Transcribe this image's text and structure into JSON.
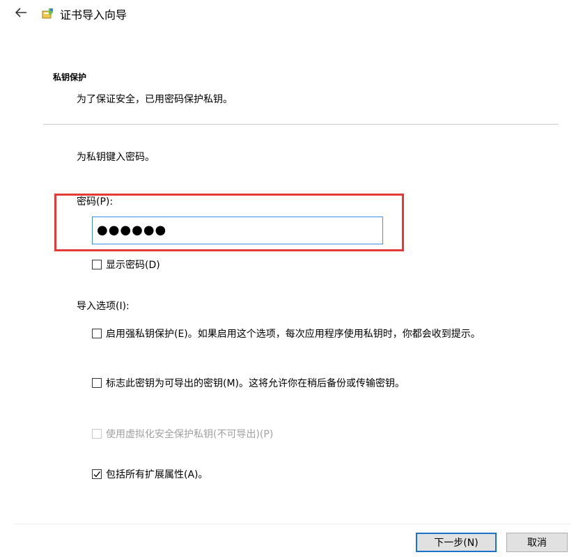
{
  "header": {
    "title": "证书导入向导",
    "back_icon": "back-arrow-icon",
    "app_icon": "certificate-wizard-icon"
  },
  "section": {
    "title": "私钥保护",
    "description": "为了保证安全，已用密码保护私钥。"
  },
  "prompt": "为私钥键入密码。",
  "password": {
    "label": "密码(P):",
    "value": "●●●●●●"
  },
  "show_password": {
    "label": "显示密码(D)",
    "checked": false
  },
  "import_options": {
    "label": "导入选项(I):",
    "items": [
      {
        "label": "启用强私钥保护(E)。如果启用这个选项，每次应用程序使用私钥时，你都会收到提示。",
        "checked": false,
        "enabled": true
      },
      {
        "label": "标志此密钥为可导出的密钥(M)。这将允许你在稍后备份或传输密钥。",
        "checked": false,
        "enabled": true
      },
      {
        "label": "使用虚拟化安全保护私钥(不可导出)(P)",
        "checked": false,
        "enabled": false
      },
      {
        "label": "包括所有扩展属性(A)。",
        "checked": true,
        "enabled": true
      }
    ]
  },
  "buttons": {
    "next": "下一步(N)",
    "cancel": "取消"
  },
  "colors": {
    "highlight": "#e53935",
    "input_border": "#3a8ee6",
    "default_button_border": "#1a73c9"
  }
}
